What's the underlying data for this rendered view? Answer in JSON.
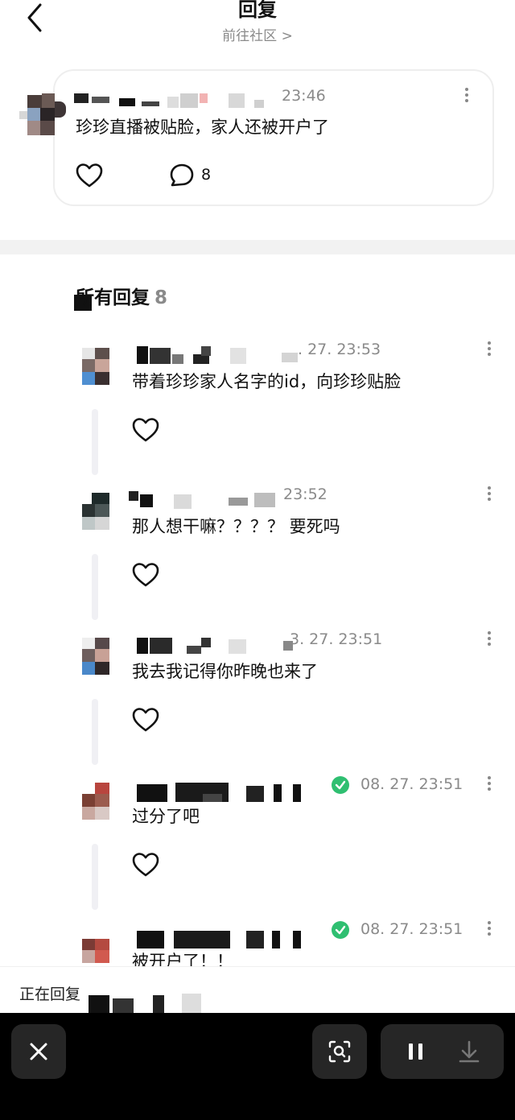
{
  "header": {
    "title": "回复",
    "community_link": "前往社区 >"
  },
  "post": {
    "time": "23:46",
    "text": "珍珍直播被贴脸，家人还被开户了",
    "comment_count": "8"
  },
  "replies_section": {
    "title": "所有回复",
    "count": "8"
  },
  "replies": [
    {
      "time": ". 27. 23:53",
      "text": "带着珍珍家人名字的id，向珍珍贴脸",
      "verified": false
    },
    {
      "time": "23:52",
      "text": "那人想干嘛？？？？ 要死吗",
      "verified": false
    },
    {
      "time": "3. 27. 23:51",
      "text": "我去我记得你昨晚也来了",
      "verified": false
    },
    {
      "time": "08. 27. 23:51",
      "text": "过分了吧",
      "verified": true
    },
    {
      "time": "08. 27. 23:51",
      "text": "被开户了！！",
      "verified": true
    }
  ],
  "reply_bar": {
    "status_text": "正在回复"
  },
  "icons": {
    "back": "chevron-left-icon",
    "more": "more-vertical-icon",
    "like": "heart-icon",
    "comment": "comment-bubble-icon",
    "verified": "verified-check-icon",
    "close": "close-icon",
    "scan": "screen-scan-icon",
    "pause": "pause-icon",
    "download": "download-icon"
  },
  "colors": {
    "verified_green": "#2fbf71",
    "muted_text": "#8a8a8a",
    "bottom_bar": "#000000",
    "button_bg": "#262626"
  }
}
